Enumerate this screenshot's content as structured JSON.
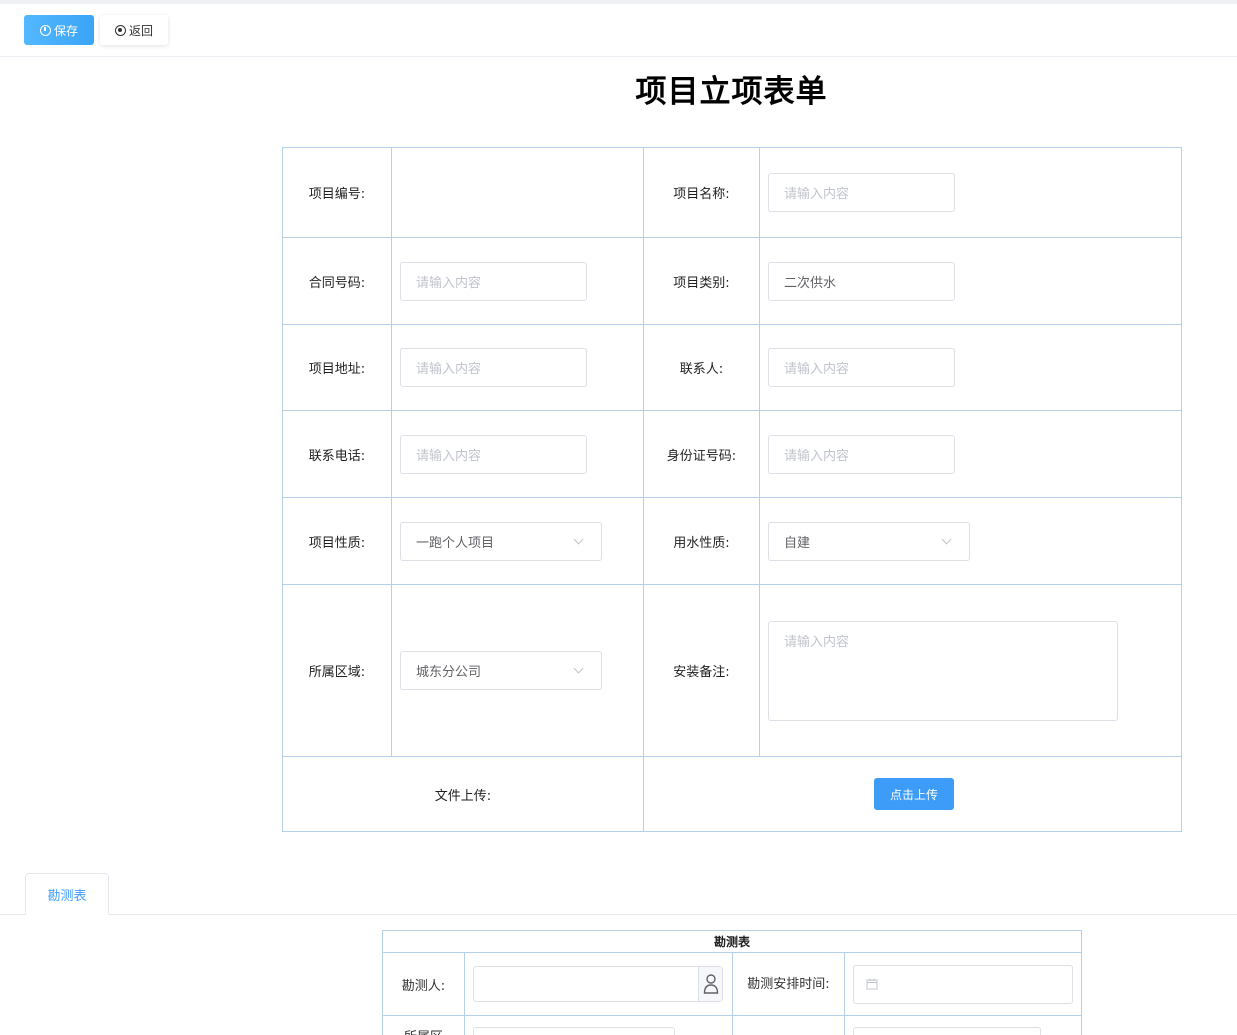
{
  "toolbar": {
    "save_label": "保存",
    "back_label": "返回"
  },
  "page_title": "项目立项表单",
  "form": {
    "project_no": {
      "label": "项目编号:",
      "value": ""
    },
    "project_name": {
      "label": "项目名称:",
      "placeholder": "请输入内容"
    },
    "contract_no": {
      "label": "合同号码:",
      "placeholder": "请输入内容"
    },
    "project_type": {
      "label": "项目类别:",
      "value": "二次供水"
    },
    "project_address": {
      "label": "项目地址:",
      "placeholder": "请输入内容"
    },
    "contact": {
      "label": "联系人:",
      "placeholder": "请输入内容"
    },
    "phone": {
      "label": "联系电话:",
      "placeholder": "请输入内容"
    },
    "id_number": {
      "label": "身份证号码:",
      "placeholder": "请输入内容"
    },
    "project_nature": {
      "label": "项目性质:",
      "value": "一跑个人项目"
    },
    "water_nature": {
      "label": "用水性质:",
      "value": "自建"
    },
    "region": {
      "label": "所属区域:",
      "value": "城东分公司"
    },
    "install_note": {
      "label": "安装备注:",
      "placeholder": "请输入内容"
    },
    "upload": {
      "label": "文件上传:",
      "button": "点击上传"
    }
  },
  "tabs": [
    {
      "label": "勘测表",
      "active": true
    }
  ],
  "survey": {
    "title": "勘测表",
    "surveyor_label": "勘测人:",
    "schedule_label": "勘测安排时间:",
    "region_label": "所属区"
  },
  "colors": {
    "primary": "#409eff",
    "border": "#b6d0ea",
    "placeholder": "#c0c4cc"
  }
}
